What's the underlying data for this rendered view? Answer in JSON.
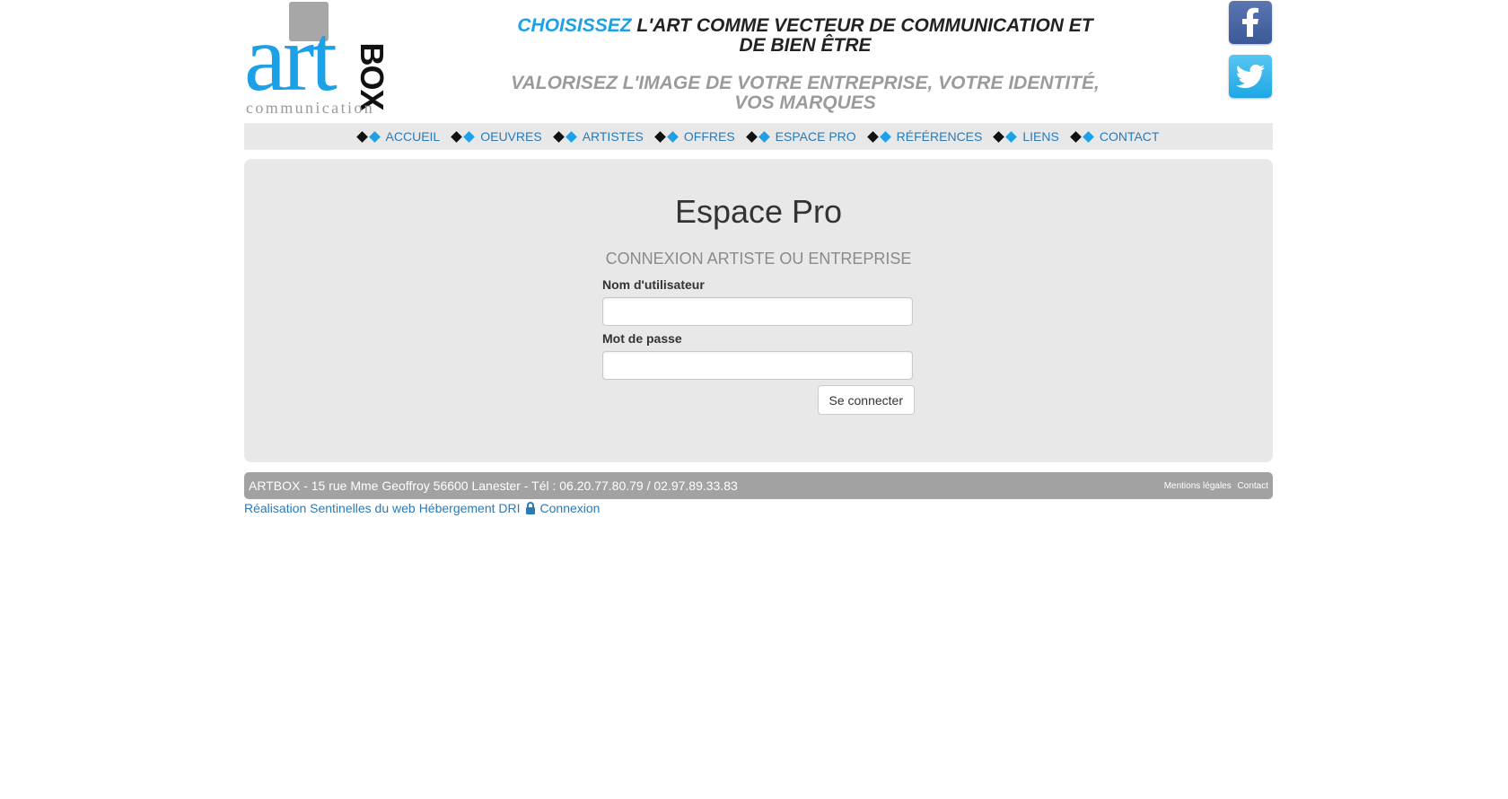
{
  "header": {
    "logo": {
      "word1": "art",
      "word2": "BOX",
      "word3": "communication"
    },
    "tagline1": {
      "highlight": "CHOISISSEZ",
      "rest": " L'ART COMME VECTEUR DE COMMUNICATION ET DE BIEN ÊTRE"
    },
    "tagline2": "VALORISEZ L'IMAGE DE VOTRE ENTREPRISE, VOTRE IDENTITÉ, VOS MARQUES",
    "social": {
      "facebook_icon": "facebook-icon",
      "twitter_icon": "twitter-icon"
    }
  },
  "nav": {
    "items": [
      {
        "label": "ACCUEIL"
      },
      {
        "label": "OEUVRES"
      },
      {
        "label": "ARTISTES"
      },
      {
        "label": "OFFRES"
      },
      {
        "label": "ESPACE PRO"
      },
      {
        "label": "RÉFÉRENCES"
      },
      {
        "label": "LIENS"
      },
      {
        "label": "CONTACT"
      }
    ],
    "colors": {
      "bullet_dark": "#111111",
      "bullet_accent": "#1ca0e6",
      "link": "#2a7ab8"
    }
  },
  "main": {
    "title": "Espace Pro",
    "subtitle": "CONNEXION ARTISTE OU ENTREPRISE",
    "username_label": "Nom d'utilisateur",
    "username_value": "",
    "password_label": "Mot de passe",
    "password_value": "",
    "submit_label": "Se connecter"
  },
  "footer": {
    "address": "ARTBOX - 15 rue Mme Geoffroy 56600 Lanester - Tél : 06.20.77.80.79 / 02.97.89.33.83",
    "links": [
      "Mentions légales",
      "Contact"
    ],
    "credits": {
      "realisation": "Réalisation Sentinelles du web",
      "hebergement": "Hébergement DRI",
      "connexion": "Connexion"
    }
  }
}
